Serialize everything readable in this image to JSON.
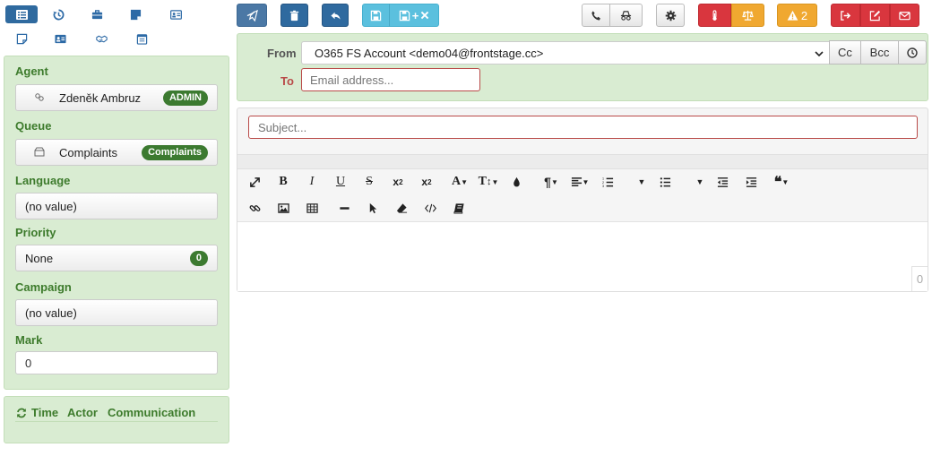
{
  "left_nav": {
    "row1": [
      "list-view-icon",
      "history-icon",
      "briefcase-icon",
      "sticky-note-icon",
      "contact-card-icon"
    ],
    "row2": [
      "note-icon",
      "id-card-icon",
      "handshake-icon",
      "calendar-icon"
    ]
  },
  "sidebar": {
    "agent_label": "Agent",
    "agent_value": "Zdeněk Ambruz",
    "agent_badge": "ADMIN",
    "queue_label": "Queue",
    "queue_value": "Complaints",
    "queue_badge": "Complaints",
    "language_label": "Language",
    "language_value": "(no value)",
    "priority_label": "Priority",
    "priority_value": "None",
    "priority_badge": "0",
    "campaign_label": "Campaign",
    "campaign_value": "(no value)",
    "mark_label": "Mark",
    "mark_value": "0"
  },
  "history_panel": {
    "tab_time": "Time",
    "tab_actor": "Actor",
    "tab_communication": "Communication"
  },
  "toolbar": {
    "alert_count": "2",
    "save_plus_label": "+"
  },
  "compose": {
    "from_label": "From",
    "from_value": "O365 FS Account <demo04@frontstage.cc>",
    "cc_label": "Cc",
    "bcc_label": "Bcc",
    "to_label": "To",
    "to_placeholder": "Email address...",
    "subject_placeholder": "Subject...",
    "char_count": "0"
  },
  "colors": {
    "panel_bg": "#d9ecd2",
    "label_green": "#3d7b2c",
    "badge_green": "#3c7a30",
    "primary_blue": "#2f6a9f",
    "info_cyan": "#5bc0de",
    "danger_red": "#d9363e",
    "warning_orange": "#f0a830",
    "error_border": "#b94a48"
  }
}
